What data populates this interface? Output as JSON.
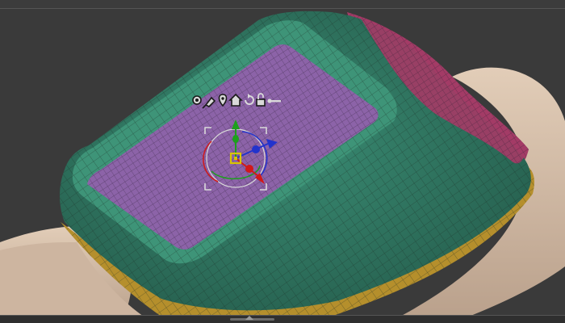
{
  "viewport": {
    "kind": "3d-sculpt-viewport",
    "model": "polygroup-mesh",
    "colors": {
      "background": "#3a3a3a",
      "base_skin": "#d8c2ad",
      "rim_green": "#2f7d66",
      "rim_outer_green": "#286a57",
      "inner_purple": "#8c63a8",
      "top_magenta": "#a33c66",
      "bottom_gold": "#b58f2c",
      "wire": "#1b2b24"
    }
  },
  "gizmo": {
    "toolbar_icons": [
      "gear-icon",
      "pin-icon",
      "location-marker-icon",
      "home-icon",
      "reset-rotation-icon",
      "lock-icon",
      "key-icon"
    ],
    "axis_colors": {
      "x": "#d11919",
      "y": "#1da01d",
      "z": "#2233cc",
      "center": "#d8c400"
    }
  }
}
